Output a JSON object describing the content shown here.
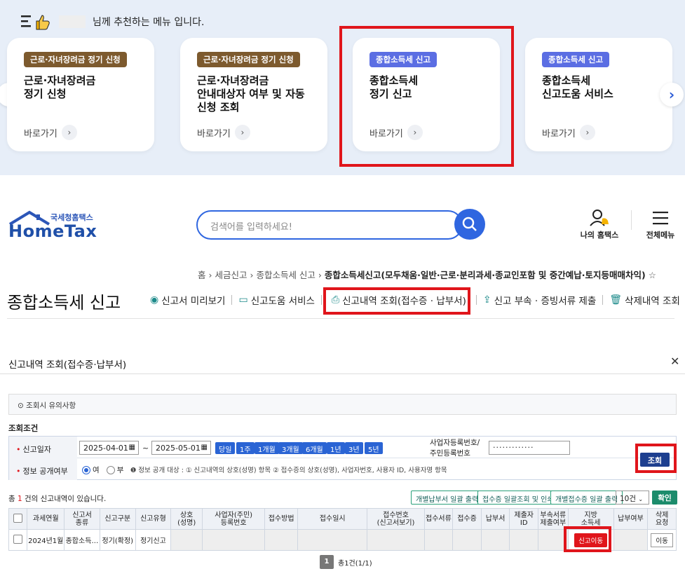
{
  "recommend": {
    "title_suffix": "님께 추천하는 메뉴 입니다.",
    "cards": [
      {
        "badge": "근로·자녀장려금 정기 신청",
        "badge_color": "#7d5a2e",
        "title": "근로·자녀장려금\n정기 신청",
        "link": "바로가기"
      },
      {
        "badge": "근로·자녀장려금 정기 신청",
        "badge_color": "#7d5a2e",
        "title": "근로·자녀장려금\n안내대상자 여부 및 자동\n신청 조회",
        "link": "바로가기"
      },
      {
        "badge": "종합소득세 신고",
        "badge_color": "#5b6ee3",
        "title": "종합소득세\n정기 신고",
        "link": "바로가기"
      },
      {
        "badge": "종합소득세 신고",
        "badge_color": "#5b6ee3",
        "title": "종합소득세\n신고도움 서비스",
        "link": "바로가기"
      }
    ]
  },
  "header": {
    "logo_small": "국세청홈택스",
    "logo_big": "HomeTax",
    "search_placeholder": "검색어를 입력하세요!",
    "my_hometax": "나의 홈택스",
    "all_menu": "전체메뉴"
  },
  "breadcrumb": {
    "items": [
      "홈",
      "세금신고",
      "종합소득세 신고"
    ],
    "current": "종합소득세신고(모두채움·일반·근로·분리과세·종교인포함 및 중간예납·토지등매매차익)"
  },
  "page": {
    "title": "종합소득세 신고",
    "tabs": [
      "신고서 미리보기",
      "신고도움 서비스",
      "신고내역 조회(접수증 · 납부서)",
      "신고 부속 · 증빙서류 제출",
      "삭제내역 조회"
    ]
  },
  "popup": {
    "title": "신고내역 조회(접수증·납부서)",
    "notice": "조회시 유의사항",
    "cond_title": "조회조건",
    "date_label": "신고일자",
    "date_from": "2025-04-01",
    "date_to": "2025-05-01",
    "tilde": "~",
    "quick": [
      "당일",
      "1주",
      "1개월",
      "3개월",
      "6개월",
      "1년",
      "3년",
      "5년"
    ],
    "biz_label_1": "사업자등록번호/",
    "biz_label_2": "주민등록번호",
    "biz_value": "·············",
    "search_btn": "조회",
    "disclosure_label": "정보 공개여부",
    "radio_yes": "여",
    "radio_no": "부",
    "disclosure_note": "정보 공개 대상 : ① 신고내역의 상호(성명) 항목 ② 접수증의 상호(성명), 사업자번호, 사용자 ID, 사용자명 항목",
    "count_prefix": "총 ",
    "count_num": "1",
    "count_suffix": " 건의 신고내역이 있습니다.",
    "buttons": [
      "개별납부서 일괄 출력",
      "접수증 일괄조회 및 인쇄",
      "개별접수증 일괄 출력"
    ],
    "page_size": "10건",
    "confirm": "확인",
    "columns": [
      "과세연월",
      "신고서\n종류",
      "신고구분",
      "신고유형",
      "상호\n(성명)",
      "사업자(주민)\n등록번호",
      "접수방법",
      "접수일시",
      "접수번호\n(신고서보기)",
      "접수서류",
      "접수증",
      "납부서",
      "제출자\nID",
      "부속서류\n제출여부",
      "지방\n소득세",
      "납부여부",
      "삭제\n요청"
    ],
    "row": {
      "period": "2024년1월",
      "kind": "종합소득…",
      "div": "정기(확정)",
      "type": "정기신고",
      "local_tax_btn": "신고이동",
      "delete_btn": "이동"
    },
    "pager_page": "1",
    "pager_text": "총1건(1/1)"
  }
}
